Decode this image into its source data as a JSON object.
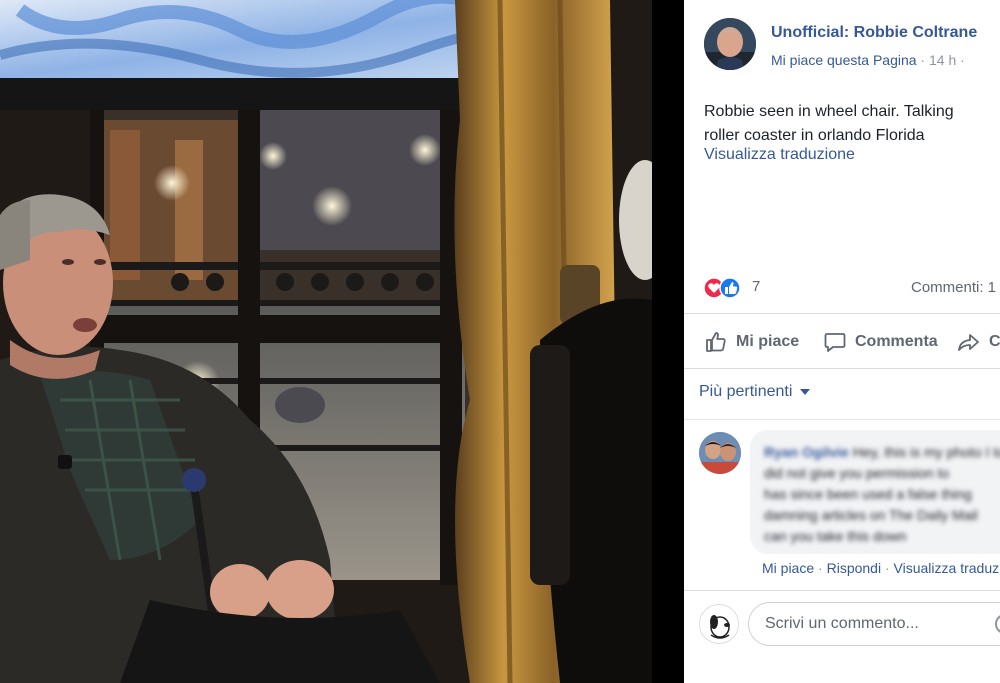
{
  "post": {
    "page_name": "Unofficial: Robbie Coltrane",
    "like_page_label": "Mi piace questa Pagina",
    "separator": " · ",
    "time": "14 h",
    "time_suffix": " ·",
    "text_line1": "Robbie seen in wheel chair. Talking",
    "text_line2": "roller coaster in orlando Florida",
    "translate_label": "Visualizza traduzione",
    "reaction_count": "7",
    "comments_label": "Commenti: 1"
  },
  "actions": {
    "like": "Mi piace",
    "comment": "Comment a",
    "share": "Condividi"
  },
  "comments": {
    "sort_label": "Più pertinenti",
    "first": {
      "author": "Ryan Ogilvie",
      "line1": "Hey, this is my photo I took.",
      "line2": "did not give you permission to",
      "line3": "has since been used a false thing",
      "line4": "damning articles on The Daily Mail",
      "line5": "can you take this down",
      "like": "Mi piace",
      "reply": "Rispondi",
      "view_translation": "Visualizza traduzione",
      "dot": " · "
    },
    "write_placeholder": "Scrivi un commento..."
  },
  "colors": {
    "link_blue": "#365899",
    "meta_gray": "#90949c",
    "action_gray": "#606770",
    "bubble_bg": "#f2f3f5",
    "love_red": "#f0284a",
    "like_blue": "#1877f2"
  },
  "icons": {
    "reactions": [
      "love-icon",
      "like-icon"
    ],
    "like": "thumbs-up-icon",
    "comment": "speech-bubble-icon",
    "share": "share-arrow-icon",
    "sort": "chevron-down-icon"
  }
}
